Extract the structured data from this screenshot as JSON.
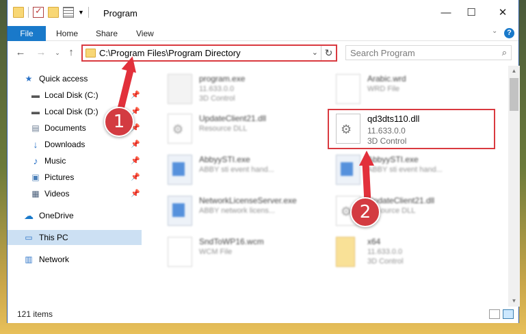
{
  "window": {
    "title": "Program"
  },
  "ribbon": {
    "tabs": [
      "File",
      "Home",
      "Share",
      "View"
    ]
  },
  "address": {
    "path": "C:\\Program Files\\Program Directory"
  },
  "search": {
    "placeholder": "Search Program"
  },
  "sidebar": {
    "items": [
      {
        "label": "Quick access",
        "icon": "star-icon"
      },
      {
        "label": "Local Disk (C:)",
        "icon": "drive-icon"
      },
      {
        "label": "Local Disk (D:)",
        "icon": "drive-icon"
      },
      {
        "label": "Documents",
        "icon": "documents-icon"
      },
      {
        "label": "Downloads",
        "icon": "download-arrow-icon"
      },
      {
        "label": "Music",
        "icon": "music-note-icon"
      },
      {
        "label": "Pictures",
        "icon": "pictures-icon"
      },
      {
        "label": "Videos",
        "icon": "videos-icon"
      },
      {
        "label": "OneDrive",
        "icon": "cloud-icon"
      },
      {
        "label": "This PC",
        "icon": "monitor-icon"
      },
      {
        "label": "Network",
        "icon": "network-icon"
      }
    ]
  },
  "files": [
    {
      "name": "program.exe",
      "line1": "11.633.0.0",
      "line2": "3D Control"
    },
    {
      "name": "Arabic.wrd",
      "line1": "WRD File",
      "line2": ""
    },
    {
      "name": "UpdateClient21.dll",
      "line1": "Resource DLL",
      "line2": ""
    },
    {
      "name": "qd3dts110.dll",
      "line1": "11.633.0.0",
      "line2": "3D Control"
    },
    {
      "name": "AbbyySTI.exe",
      "line1": "ABBY sti event hand...",
      "line2": ""
    },
    {
      "name": "AbbyySTI.exe",
      "line1": "ABBY sti event hand...",
      "line2": ""
    },
    {
      "name": "NetworkLicenseServer.exe",
      "line1": "ABBY network licens...",
      "line2": ""
    },
    {
      "name": "UpdateClient21.dll",
      "line1": "Resource DLL",
      "line2": ""
    },
    {
      "name": "SndToWP16.wcm",
      "line1": "WCM File",
      "line2": ""
    },
    {
      "name": "x64",
      "line1": "11.633.0.0",
      "line2": "3D Control"
    }
  ],
  "status": {
    "count": "121 items"
  },
  "annotations": {
    "step1": "1",
    "step2": "2"
  },
  "colors": {
    "accent": "#1979ca",
    "highlight": "#d9393f"
  }
}
